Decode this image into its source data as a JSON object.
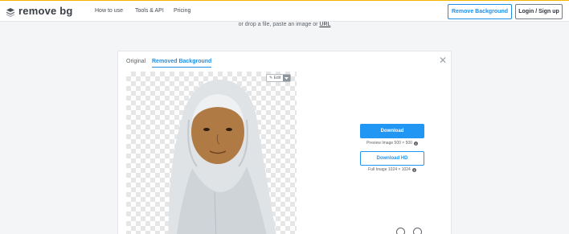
{
  "brand": {
    "name": "remove bg",
    "logo_icon": "remove-bg-logo-icon",
    "accent": "#1f8fe6"
  },
  "nav": {
    "links": [
      "How to use",
      "Tools & API",
      "Pricing"
    ],
    "remove_background_label": "Remove Background",
    "login_label": "Login / Sign up"
  },
  "upload": {
    "hint_prefix": "or drop a file, paste an image or",
    "url_label": "URL"
  },
  "result": {
    "tabs": [
      "Original",
      "Removed Background"
    ],
    "active_tab": "Removed Background",
    "close_icon": "close-icon",
    "edit_label": "Edit",
    "download_label": "Download",
    "preview_info": "Preview Image 500 × 500",
    "download_hd_label": "Download HD",
    "full_info": "Full Image 1024 × 1024"
  }
}
